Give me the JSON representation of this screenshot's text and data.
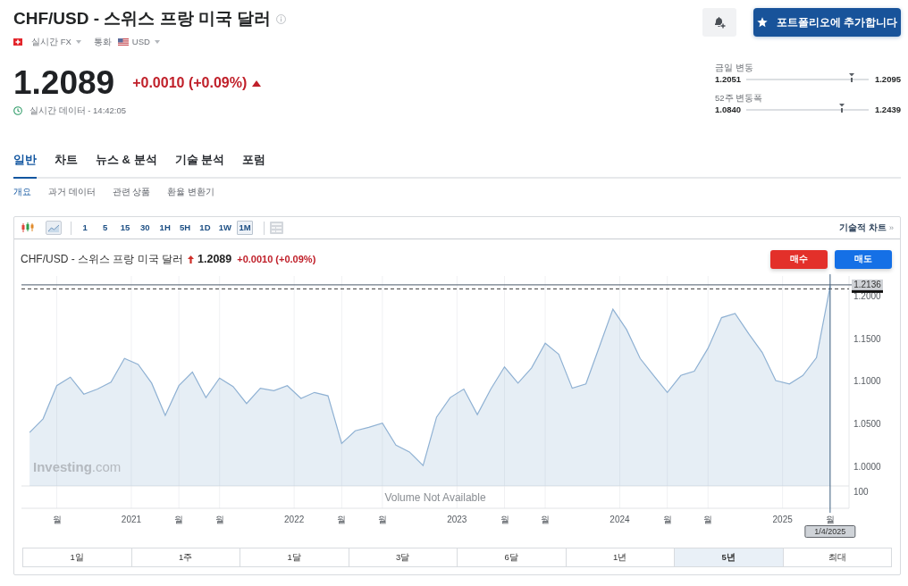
{
  "header": {
    "title": "CHF/USD - 스위스 프랑 미국 달러",
    "market": "실시간 FX",
    "currency_label": "통화",
    "currency": "USD",
    "price": "1.2089",
    "change": "+0.0010 (+0.09%)",
    "rising": true,
    "data_status": "실시간 데이터 - 14:42:05"
  },
  "portfolio_button": "포트폴리오에 추가합니다",
  "ranges": [
    {
      "label": "금일 변동",
      "low": "1.2051",
      "high": "1.2095",
      "level": 0.86
    },
    {
      "label": "52주 변동폭",
      "low": "1.0840",
      "high": "1.2439",
      "level": 0.78
    }
  ],
  "tabs": [
    {
      "label": "일반",
      "selected": true
    },
    {
      "label": "차트",
      "selected": false
    },
    {
      "label": "뉴스 & 분석",
      "selected": false
    },
    {
      "label": "기술 분석",
      "selected": false
    },
    {
      "label": "포럼",
      "selected": false
    }
  ],
  "subtabs": [
    {
      "label": "개요",
      "selected": true
    },
    {
      "label": "과거 데이터",
      "selected": false
    },
    {
      "label": "관련 상품",
      "selected": false
    },
    {
      "label": "환율 변환기",
      "selected": false
    }
  ],
  "chart_widget": {
    "chart_types": [
      {
        "kind": "candlestick",
        "selected": false
      },
      {
        "kind": "area",
        "selected": true
      }
    ],
    "intervals": [
      {
        "label": "1",
        "selected": false
      },
      {
        "label": "5",
        "selected": false
      },
      {
        "label": "15",
        "selected": false
      },
      {
        "label": "30",
        "selected": false
      },
      {
        "label": "1H",
        "selected": false
      },
      {
        "label": "5H",
        "selected": false
      },
      {
        "label": "1D",
        "selected": false
      },
      {
        "label": "1W",
        "selected": false
      },
      {
        "label": "1M",
        "selected": true
      }
    ],
    "advanced_link": {
      "label": "기술적 차트",
      "arrow": "»"
    },
    "legend": {
      "name": "CHF/USD - 스위스 프랑 미국 달러",
      "rising": true,
      "price": "1.2089",
      "change": "+0.0010 (+0.09%)"
    },
    "buy_button": "매수",
    "sell_button": "매도",
    "logo": "**Investing**.com",
    "volume_note": "Volume Not Available",
    "volume_tick": "100",
    "chart_data": {
      "type": "area",
      "x": [
        2020.375,
        2020.458,
        2020.542,
        2020.625,
        2020.708,
        2020.792,
        2020.875,
        2020.958,
        2021.042,
        2021.125,
        2021.208,
        2021.292,
        2021.375,
        2021.458,
        2021.542,
        2021.625,
        2021.708,
        2021.792,
        2021.875,
        2021.958,
        2022.042,
        2022.125,
        2022.208,
        2022.292,
        2022.375,
        2022.458,
        2022.542,
        2022.625,
        2022.708,
        2022.792,
        2022.875,
        2022.958,
        2023.042,
        2023.125,
        2023.208,
        2023.292,
        2023.375,
        2023.458,
        2023.542,
        2023.625,
        2023.708,
        2023.792,
        2023.875,
        2023.958,
        2024.042,
        2024.125,
        2024.208,
        2024.292,
        2024.375,
        2024.458,
        2024.542,
        2024.625,
        2024.708,
        2024.792,
        2024.875,
        2024.958,
        2025.042,
        2025.125,
        2025.208,
        2025.292
      ],
      "series": [
        {
          "color": "#8fb1d3",
          "values": [
            1.04,
            1.056,
            1.095,
            1.105,
            1.085,
            1.091,
            1.099,
            1.127,
            1.12,
            1.098,
            1.06,
            1.095,
            1.111,
            1.081,
            1.104,
            1.094,
            1.074,
            1.092,
            1.089,
            1.095,
            1.08,
            1.087,
            1.083,
            1.027,
            1.042,
            1.046,
            1.051,
            1.025,
            1.017,
            1.001,
            1.058,
            1.081,
            1.091,
            1.061,
            1.091,
            1.117,
            1.098,
            1.116,
            1.145,
            1.132,
            1.092,
            1.097,
            1.141,
            1.185,
            1.161,
            1.127,
            1.107,
            1.087,
            1.107,
            1.112,
            1.139,
            1.175,
            1.18,
            1.156,
            1.134,
            1.101,
            1.097,
            1.107,
            1.128,
            1.212
          ]
        }
      ],
      "xlim": [
        2020.325,
        2025.408
      ],
      "ylim": [
        0.977,
        1.224
      ],
      "xticks": [
        {
          "value": 2020.542,
          "label": "월"
        },
        {
          "value": 2021,
          "label": "2021"
        },
        {
          "value": 2021.292,
          "label": "월"
        },
        {
          "value": 2021.542,
          "label": "월"
        },
        {
          "value": 2022,
          "label": "2022"
        },
        {
          "value": 2022.292,
          "label": "월"
        },
        {
          "value": 2022.542,
          "label": "월"
        },
        {
          "value": 2023,
          "label": "2023"
        },
        {
          "value": 2023.292,
          "label": "월"
        },
        {
          "value": 2023.542,
          "label": "월"
        },
        {
          "value": 2024,
          "label": "2024"
        },
        {
          "value": 2024.292,
          "label": "월"
        },
        {
          "value": 2024.542,
          "label": "월"
        },
        {
          "value": 2025,
          "label": "2025"
        },
        {
          "value": 2025.292,
          "label": "월"
        }
      ],
      "yticks": [
        {
          "value": 1.0,
          "label": "1.0000"
        },
        {
          "value": 1.05,
          "label": "1.0500"
        },
        {
          "value": 1.1,
          "label": "1.1000"
        },
        {
          "value": 1.15,
          "label": "1.1500"
        },
        {
          "value": 1.2,
          "label": "1.2000"
        }
      ],
      "grid": true,
      "ref_lines": [
        {
          "axis": "y",
          "value": 1.2136,
          "label": "1.2136"
        },
        {
          "axis": "y",
          "value": 1.2089,
          "color": "#3a3a3a"
        },
        {
          "axis": "x",
          "value": 2025.292,
          "label": "1/4/2025"
        }
      ]
    },
    "periods": [
      {
        "label": "1일",
        "selected": false
      },
      {
        "label": "1주",
        "selected": false
      },
      {
        "label": "1달",
        "selected": false
      },
      {
        "label": "3달",
        "selected": false
      },
      {
        "label": "6달",
        "selected": false
      },
      {
        "label": "1년",
        "selected": false
      },
      {
        "label": "5년",
        "selected": true
      },
      {
        "label": "최대",
        "selected": false
      }
    ]
  }
}
